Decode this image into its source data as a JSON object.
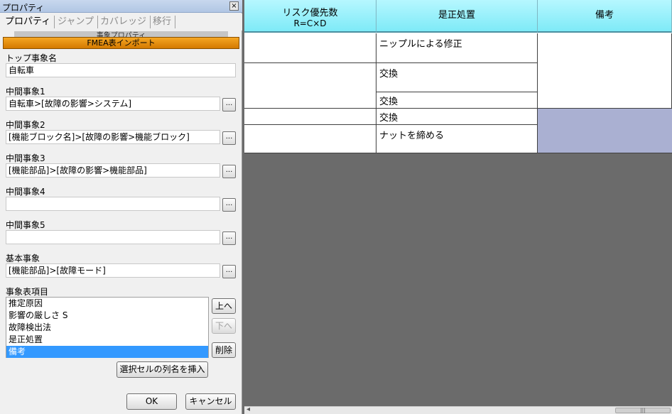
{
  "window": {
    "title": "プロパティ",
    "close_glyph": "×"
  },
  "tabs": [
    "プロパティ",
    "ジャンプ",
    "カバレッジ",
    "移行"
  ],
  "partial_header_text": "事象プロパティ",
  "import_button": "FMEA表インポート",
  "fields": [
    {
      "label": "トップ事象名",
      "value": "自転車",
      "has_browse": false
    },
    {
      "label": "中間事象1",
      "value": "自転車>[故障の影響>システム]",
      "has_browse": true
    },
    {
      "label": "中間事象2",
      "value": "[機能ブロック名]>[故障の影響>機能ブロック]",
      "has_browse": true
    },
    {
      "label": "中間事象3",
      "value": "[機能部品]>[故障の影響>機能部品]",
      "has_browse": true
    },
    {
      "label": "中間事象4",
      "value": "",
      "has_browse": true
    },
    {
      "label": "中間事象5",
      "value": "",
      "has_browse": true
    },
    {
      "label": "基本事象",
      "value": "[機能部品]>[故障モード]",
      "has_browse": true
    }
  ],
  "browse_label": "...",
  "event_items": {
    "label": "事象表項目",
    "items": [
      "推定原因",
      "影響の厳しさ S",
      "故障検出法",
      "是正処置",
      "備考"
    ],
    "selected_index": 4
  },
  "side_buttons": {
    "up": "上へ",
    "down": "下へ",
    "delete": "削除"
  },
  "insert_button": "選択セルの列名を挿入",
  "ok_button": "OK",
  "cancel_button": "キャンセル",
  "grid": {
    "headers": [
      {
        "line1": "リスク優先数",
        "line2": "R=C×D"
      },
      {
        "line1": "是正処置",
        "line2": ""
      },
      {
        "line1": "備考",
        "line2": ""
      }
    ],
    "rows": [
      {
        "risk": "",
        "action": "ニップルによる修正"
      },
      {
        "risk": "",
        "action": "交換"
      },
      {
        "risk": "",
        "action": "交換"
      },
      {
        "risk": "",
        "action": "交換"
      },
      {
        "risk": "",
        "action": "ナットを締める"
      }
    ],
    "remarks_highlight_color": "#aab0d2",
    "header_color": "#8cf0fb"
  },
  "hscroll": {
    "left_arrow": "◂",
    "thumb_grip": "|||"
  }
}
